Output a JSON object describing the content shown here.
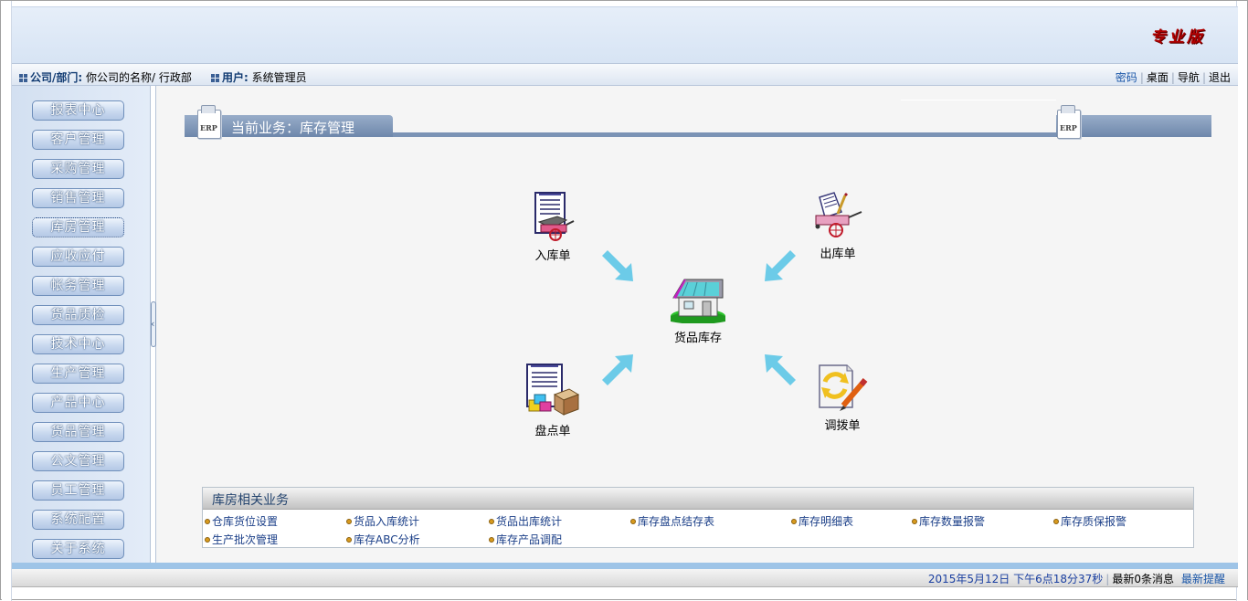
{
  "brand": "专业版",
  "info": {
    "company_label": "公司/部门:",
    "company_value": "你公司的名称/ 行政部",
    "user_label": "用户:",
    "user_value": "系统管理员"
  },
  "top_links": [
    "密码",
    "桌面",
    "导航",
    "退出"
  ],
  "sidebar": {
    "items": [
      "报表中心",
      "客户管理",
      "采购管理",
      "销售管理",
      "库房管理",
      "应收应付",
      "帐务管理",
      "货品质检",
      "技术中心",
      "生产管理",
      "产品中心",
      "货品管理",
      "公文管理",
      "员工管理",
      "系统配置",
      "关于系统"
    ],
    "active": "库房管理"
  },
  "title": {
    "prefix": "当前业务：",
    "name": "库存管理",
    "erp_badge": "ERP"
  },
  "flow": {
    "stock_in": "入库单",
    "stock_out": "出库单",
    "inventory": "货品库存",
    "stocktake": "盘点单",
    "transfer": "调拨单"
  },
  "related": {
    "title": "库房相关业务",
    "links": [
      "仓库货位设置",
      "货品入库统计",
      "货品出库统计",
      "库存盘点结存表",
      "库存明细表",
      "库存数量报警",
      "库存质保报警",
      "生产批次管理",
      "库存ABC分析",
      "库存产品调配"
    ]
  },
  "status": {
    "datetime": "2015年5月12日  下午6点18分37秒",
    "messages": "最新0条消息",
    "remind": "最新提醒"
  },
  "colors": {
    "brand": "#b00000",
    "title_bar": "#7b93b5",
    "link": "#1b3f88",
    "arrow": "#6ccbe8"
  }
}
